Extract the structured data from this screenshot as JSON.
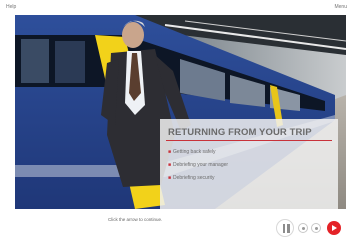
{
  "topbar": {
    "help_label": "Help",
    "menu_label": "Menu"
  },
  "slide": {
    "title": "RETURNING FROM YOUR TRIP",
    "bullets": [
      "Getting back safely",
      "Debriefing your manager",
      "Debriefing security"
    ]
  },
  "bottombar": {
    "instruction": "Click the arrow to continue."
  },
  "colors": {
    "accent": "#c8323a",
    "next_button": "#e42227",
    "panel": "#f0f0f0"
  },
  "icons": {
    "pause": "pause-icon",
    "next": "play-arrow-icon"
  }
}
